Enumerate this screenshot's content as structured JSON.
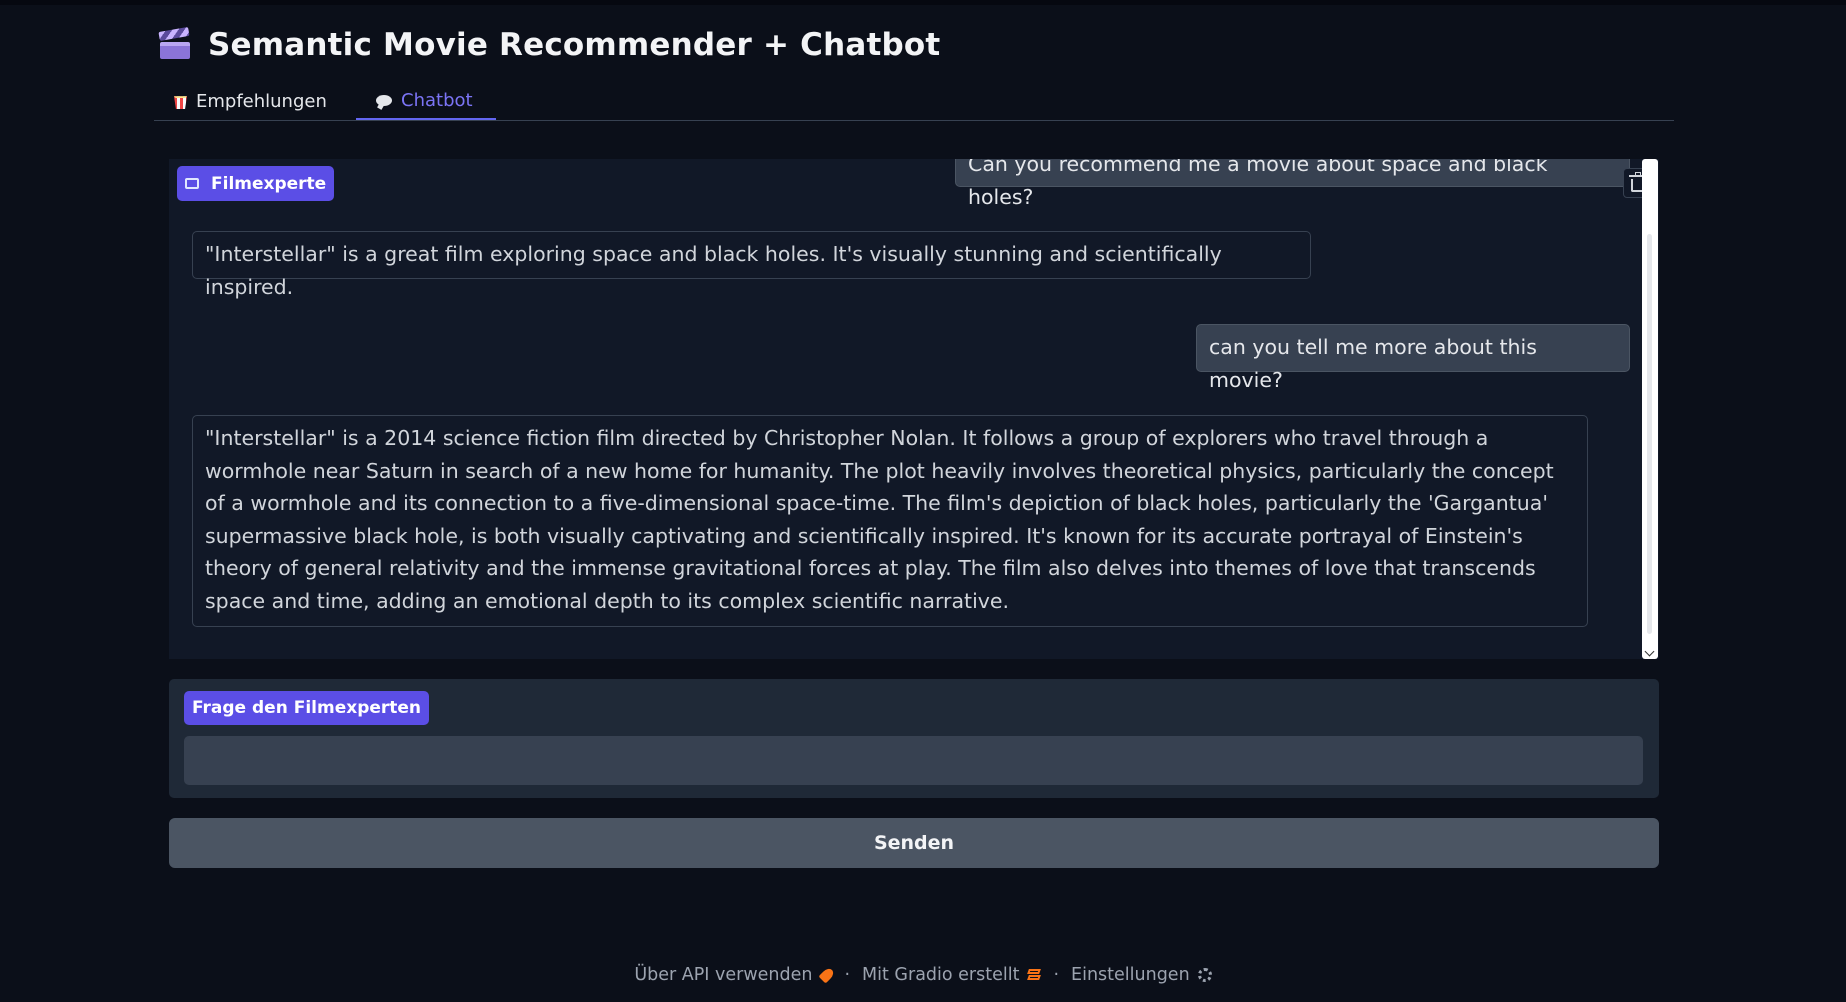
{
  "header": {
    "title": "Semantic Movie Recommender + Chatbot",
    "icon": "clapperboard-icon"
  },
  "tabs": [
    {
      "label": "Empfehlungen",
      "icon": "popcorn-icon",
      "active": false
    },
    {
      "label": "Chatbot",
      "icon": "speech-bubble-icon",
      "active": true
    }
  ],
  "chatbot": {
    "label": "Filmexperte",
    "messages": [
      {
        "role": "user",
        "text": "Can you recommend me a movie about space and black holes?"
      },
      {
        "role": "bot",
        "text": "\"Interstellar\" is a great film exploring space and black holes. It's visually stunning and scientifically inspired."
      },
      {
        "role": "user",
        "text": "can you tell me more about this movie?"
      },
      {
        "role": "bot",
        "text": "\"Interstellar\" is a 2014 science fiction film directed by Christopher Nolan. It follows a group of explorers who travel through a wormhole near Saturn in search of a new home for humanity. The plot heavily involves theoretical physics, particularly the concept of a wormhole and its connection to a five-dimensional space-time. The film's depiction of black holes, particularly the 'Gargantua' supermassive black hole, is both visually captivating and scientifically inspired. It's known for its accurate portrayal of Einstein's theory of general relativity and the immense gravitational forces at play. The film also delves into themes of love that transcends space and time, adding an emotional depth to its complex scientific narrative."
      }
    ]
  },
  "input": {
    "label": "Frage den Filmexperten",
    "value": "",
    "placeholder": ""
  },
  "send_button": {
    "label": "Senden"
  },
  "footer": {
    "api_label": "Über API verwenden",
    "gradio_label": "Mit Gradio erstellt",
    "settings_label": "Einstellungen",
    "separator": "·"
  },
  "colors": {
    "background": "#0b0f19",
    "accent": "#6366f1",
    "label_bg": "#5b4ee6",
    "input_bg": "#374151",
    "button_bg": "#4b5563"
  }
}
